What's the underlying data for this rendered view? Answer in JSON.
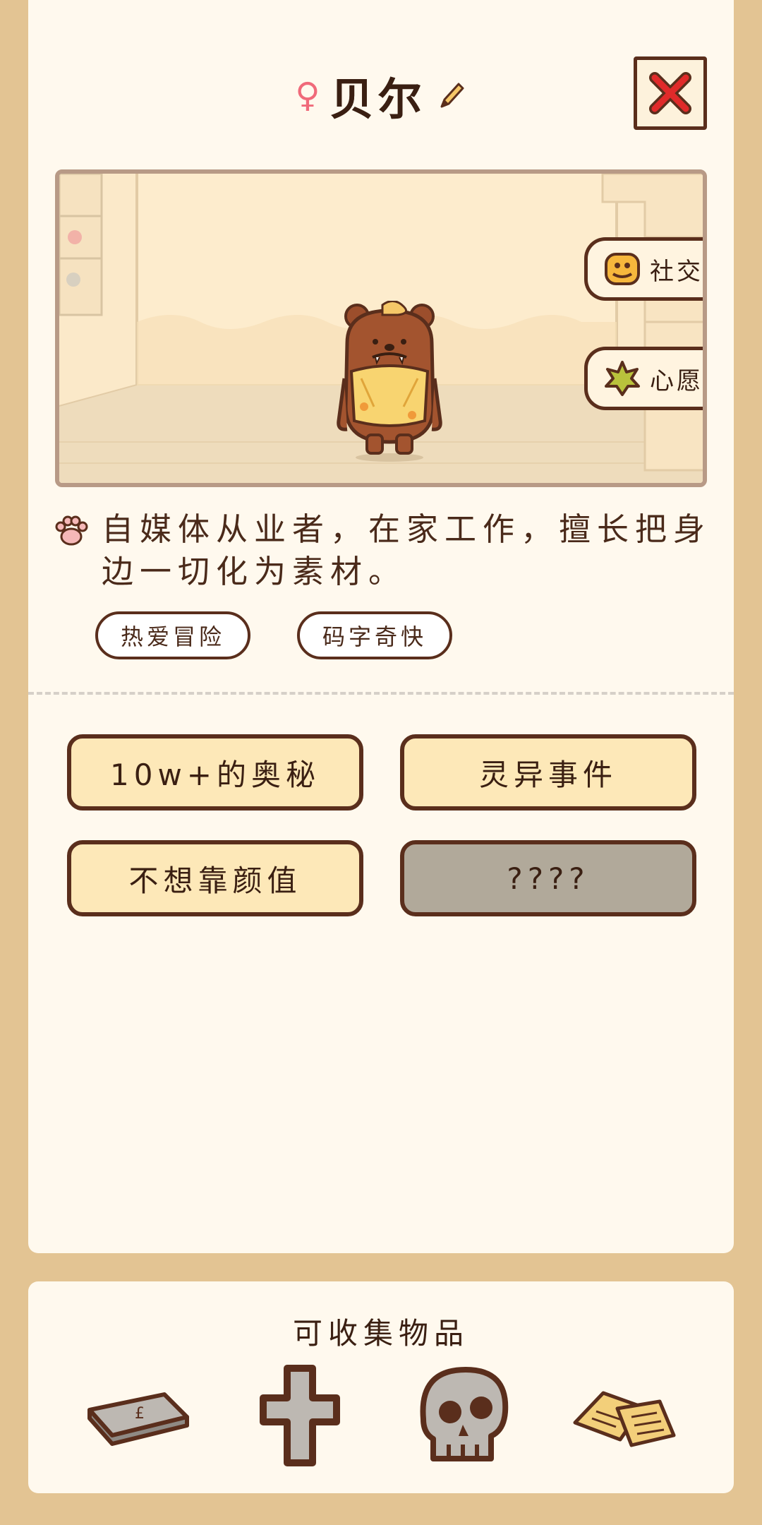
{
  "header": {
    "gender_symbol": "♀",
    "name": "贝尔"
  },
  "scene": {
    "side_buttons": [
      {
        "label": "社交",
        "icon": "social-icon"
      },
      {
        "label": "心愿",
        "icon": "wish-icon"
      }
    ]
  },
  "profile": {
    "description": "自媒体从业者，在家工作，擅长把身边一切化为素材。",
    "tags": [
      "热爱冒险",
      "码字奇快"
    ]
  },
  "stories": [
    {
      "label": "10w+的奥秘",
      "locked": false
    },
    {
      "label": "灵异事件",
      "locked": false
    },
    {
      "label": "不想靠颜值",
      "locked": false
    },
    {
      "label": "????",
      "locked": true
    }
  ],
  "collectibles": {
    "title": "可收集物品",
    "items": [
      "laptop-icon",
      "cross-icon",
      "skull-icon",
      "papers-icon"
    ]
  },
  "colors": {
    "background": "#e3c493",
    "card": "#fff9ee",
    "outline": "#5a2e1c",
    "button_fill": "#fde8b8",
    "locked_fill": "#b1a99a",
    "close_x": "#e02a2a",
    "gender": "#f06a7a"
  }
}
